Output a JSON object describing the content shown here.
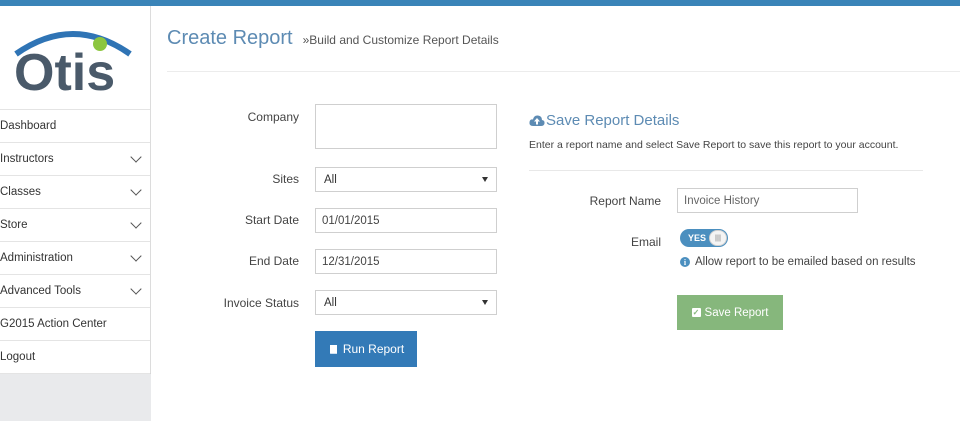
{
  "app": {
    "logo_text": "Otis",
    "accent": "#3a84b8",
    "title_color": "#5d8bb3"
  },
  "header": {
    "title": "Create Report",
    "subtitle": "»Build and Customize Report Details"
  },
  "sidebar": {
    "items": [
      {
        "label": "Dashboard",
        "chevron": false
      },
      {
        "label": "Instructors",
        "chevron": true
      },
      {
        "label": "Classes",
        "chevron": true
      },
      {
        "label": "Store",
        "chevron": true
      },
      {
        "label": "Administration",
        "chevron": true
      },
      {
        "label": "Advanced Tools",
        "chevron": true
      },
      {
        "label": "G2015 Action Center",
        "chevron": false
      },
      {
        "label": "Logout",
        "chevron": false
      }
    ]
  },
  "form": {
    "company_label": "Company",
    "company_value": "",
    "sites_label": "Sites",
    "sites_value": "All",
    "start_label": "Start Date",
    "start_value": "01/01/2015",
    "end_label": "End Date",
    "end_value": "12/31/2015",
    "invoice_label": "Invoice Status",
    "invoice_value": "All",
    "run_label": "Run Report"
  },
  "save_panel": {
    "title": "Save Report Details",
    "description": "Enter a report name and select Save Report to save this report to your account.",
    "name_label": "Report Name",
    "name_value": "Invoice History",
    "email_label": "Email",
    "toggle_label": "YES",
    "email_note": "Allow report to be emailed based on results",
    "save_label": "Save Report"
  }
}
